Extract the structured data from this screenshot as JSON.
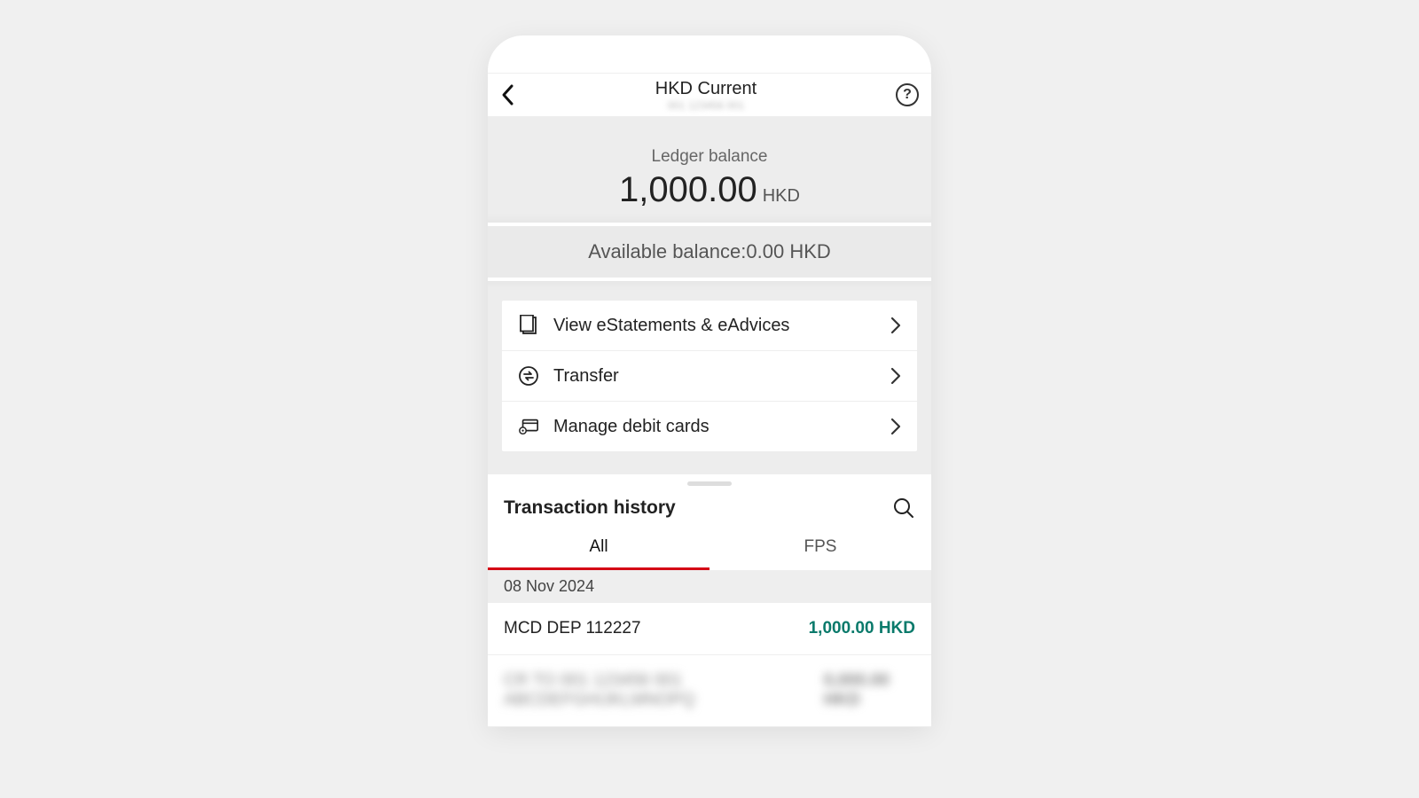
{
  "header": {
    "title": "HKD Current",
    "subtitle_masked": "001 123456 001",
    "help_glyph": "?"
  },
  "balance": {
    "ledger_label": "Ledger balance",
    "ledger_amount": "1,000.00",
    "ledger_currency": "HKD",
    "available_label": "Available balance:",
    "available_amount": "0.00",
    "available_currency": "HKD"
  },
  "menu": {
    "items": [
      {
        "icon": "document-icon",
        "label": "View eStatements & eAdvices"
      },
      {
        "icon": "transfer-icon",
        "label": "Transfer"
      },
      {
        "icon": "card-settings-icon",
        "label": "Manage debit cards"
      }
    ]
  },
  "history": {
    "title": "Transaction history",
    "tabs": [
      {
        "label": "All",
        "active": true
      },
      {
        "label": "FPS",
        "active": false
      }
    ],
    "date_group": "08 Nov 2024",
    "transactions": [
      {
        "description": "MCD DEP 112227",
        "amount": "1,000.00 HKD",
        "positive": true,
        "masked": false
      },
      {
        "description": "CR TO 001 123456 001 ABCDEFGHIJKLMNOPQ",
        "amount": "0,000.00 HKD",
        "positive": false,
        "masked": true
      }
    ]
  }
}
